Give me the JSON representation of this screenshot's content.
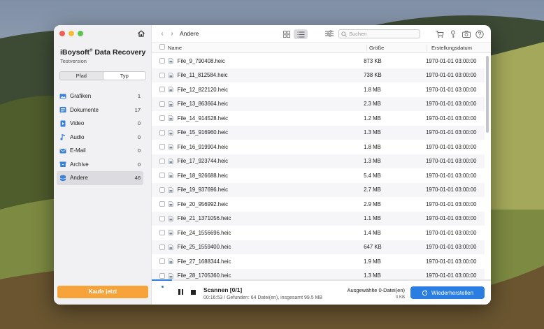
{
  "sidebar": {
    "app_name": "iBoysoft",
    "app_name_rest": " Data Recovery",
    "reg_mark": "®",
    "version": "Testversion",
    "seg": {
      "pfad": "Pfad",
      "typ": "Typ"
    },
    "categories": [
      {
        "label": "Grafiken",
        "count": "1",
        "icon": "image-icon"
      },
      {
        "label": "Dokumente",
        "count": "17",
        "icon": "document-icon"
      },
      {
        "label": "Video",
        "count": "0",
        "icon": "video-icon"
      },
      {
        "label": "Audio",
        "count": "0",
        "icon": "music-note-icon"
      },
      {
        "label": "E-Mail",
        "count": "0",
        "icon": "mail-icon"
      },
      {
        "label": "Archive",
        "count": "0",
        "icon": "archive-icon"
      },
      {
        "label": "Andere",
        "count": "46",
        "icon": "other-files-icon"
      }
    ],
    "buy_label": "Kaufe jetzt"
  },
  "toolbar": {
    "breadcrumb": "Andere",
    "search_placeholder": "Suchen"
  },
  "table": {
    "headers": {
      "name": "Name",
      "size": "Größe",
      "date": "Erstellungsdatum"
    },
    "rows": [
      {
        "name": "File_9_790408.heic",
        "size": "873 KB",
        "date": "1970-01-01 03:00:00"
      },
      {
        "name": "File_11_812584.heic",
        "size": "738 KB",
        "date": "1970-01-01 03:00:00"
      },
      {
        "name": "File_12_822120.heic",
        "size": "1.8 MB",
        "date": "1970-01-01 03:00:00"
      },
      {
        "name": "File_13_863664.heic",
        "size": "2.3 MB",
        "date": "1970-01-01 03:00:00"
      },
      {
        "name": "File_14_914528.heic",
        "size": "1.2 MB",
        "date": "1970-01-01 03:00:00"
      },
      {
        "name": "File_15_916960.heic",
        "size": "1.3 MB",
        "date": "1970-01-01 03:00:00"
      },
      {
        "name": "File_16_919904.heic",
        "size": "1.8 MB",
        "date": "1970-01-01 03:00:00"
      },
      {
        "name": "File_17_923744.heic",
        "size": "1.3 MB",
        "date": "1970-01-01 03:00:00"
      },
      {
        "name": "File_18_926688.heic",
        "size": "5.4 MB",
        "date": "1970-01-01 03:00:00"
      },
      {
        "name": "File_19_937696.heic",
        "size": "2.7 MB",
        "date": "1970-01-01 03:00:00"
      },
      {
        "name": "File_20_956992.heic",
        "size": "2.9 MB",
        "date": "1970-01-01 03:00:00"
      },
      {
        "name": "File_21_1371056.heic",
        "size": "1.1 MB",
        "date": "1970-01-01 03:00:00"
      },
      {
        "name": "File_24_1556696.heic",
        "size": "1.4 MB",
        "date": "1970-01-01 03:00:00"
      },
      {
        "name": "File_25_1559400.heic",
        "size": "647 KB",
        "date": "1970-01-01 03:00:00"
      },
      {
        "name": "File_27_1688344.heic",
        "size": "1.9 MB",
        "date": "1970-01-01 03:00:00"
      },
      {
        "name": "File_28_1705360.heic",
        "size": "1.3 MB",
        "date": "1970-01-01 03:00:00"
      }
    ]
  },
  "bottom": {
    "scan_title": "Scannen [0/1]",
    "scan_sub": "00:16:53 / Gefunden: 64 Datei(en), insgesamt  99.5 MB",
    "selected": "Ausgewählte 0-Datei(en)",
    "selected_size": "0 KB",
    "restore_label": "Wiederherstellen",
    "progress": 0.06
  },
  "colors": {
    "accent": "#2a7de1",
    "buy": "#f5a33a"
  }
}
